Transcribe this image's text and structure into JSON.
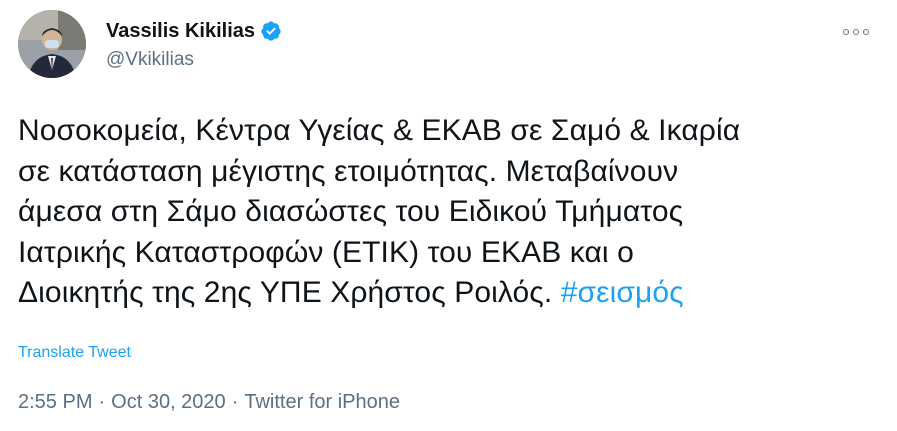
{
  "author": {
    "display_name": "Vassilis Kikilias",
    "handle": "@Vkikilias",
    "verified": true
  },
  "tweet": {
    "text_lines": [
      "Νοσοκομεία, Κέντρα Υγείας & ΕΚΑΒ σε Σαμό & Ικαρία",
      "σε κατάσταση μέγιστης ετοιμότητας. Μεταβαίνουν",
      "άμεσα στη Σάμο διασώστες του Ειδικού Τμήματος",
      "Ιατρικής Καταστροφών (ΕΤΙΚ) του ΕΚΑΒ και ο",
      "Διοικητής της 2ης ΥΠΕ Χρήστος Ροιλός. "
    ],
    "hashtag": "#σεισμός",
    "translate_label": "Translate Tweet",
    "time": "2:55 PM",
    "date": "Oct 30, 2020",
    "source": "Twitter for iPhone",
    "separator": "·"
  },
  "colors": {
    "accent": "#1da1f2",
    "secondary_text": "#5b7083",
    "primary_text": "#0f1419"
  },
  "icons": {
    "verified": "verified-badge-icon",
    "more": "more-options-icon"
  }
}
